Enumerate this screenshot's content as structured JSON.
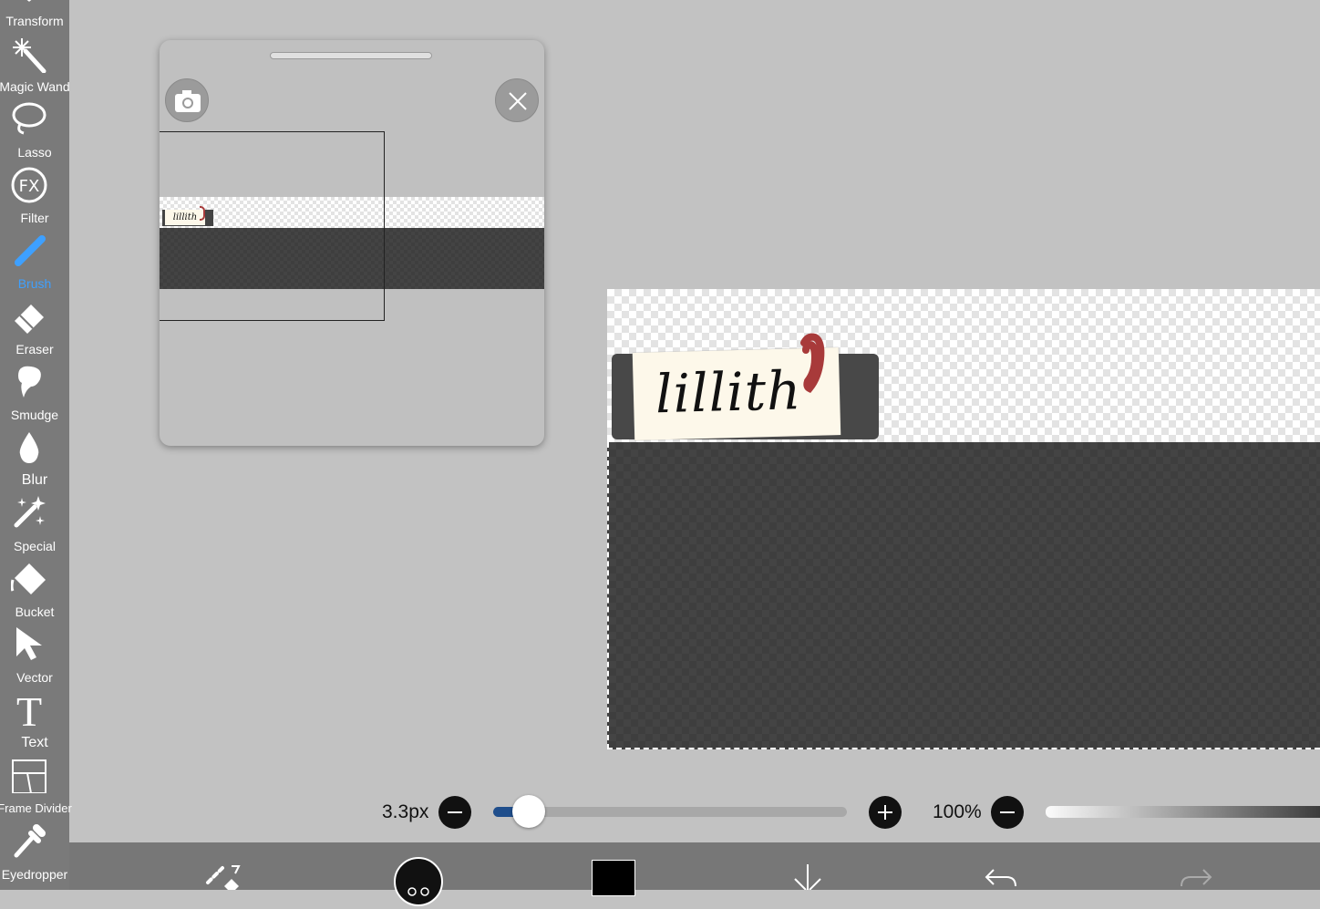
{
  "toolbar": {
    "tools": [
      {
        "label": "Transform"
      },
      {
        "label": "Magic Wand"
      },
      {
        "label": "Lasso"
      },
      {
        "label": "Filter"
      },
      {
        "label": "Brush",
        "active": true
      },
      {
        "label": "Eraser"
      },
      {
        "label": "Smudge"
      },
      {
        "label": "Blur"
      },
      {
        "label": "Special"
      },
      {
        "label": "Bucket"
      },
      {
        "label": "Vector"
      },
      {
        "label": "Text"
      },
      {
        "label": "Frame Divider"
      },
      {
        "label": "Eyedropper"
      }
    ],
    "filter_icon_text": "FX",
    "text_icon_glyph": "T",
    "active_color": "#3ea0ff"
  },
  "canvas": {
    "handwritten_label": "lillith"
  },
  "controls": {
    "brush_size": "3.3px",
    "brush_size_slider_fraction": 0.1,
    "opacity": "100%",
    "slider_accent": "#1f4e8c"
  },
  "bottom_bar": {
    "icons": [
      "brush-settings-icon",
      "brush-preview-icon",
      "color-swatch",
      "layer-icon",
      "undo-icon",
      "redo-icon"
    ],
    "current_color": "#000000"
  }
}
